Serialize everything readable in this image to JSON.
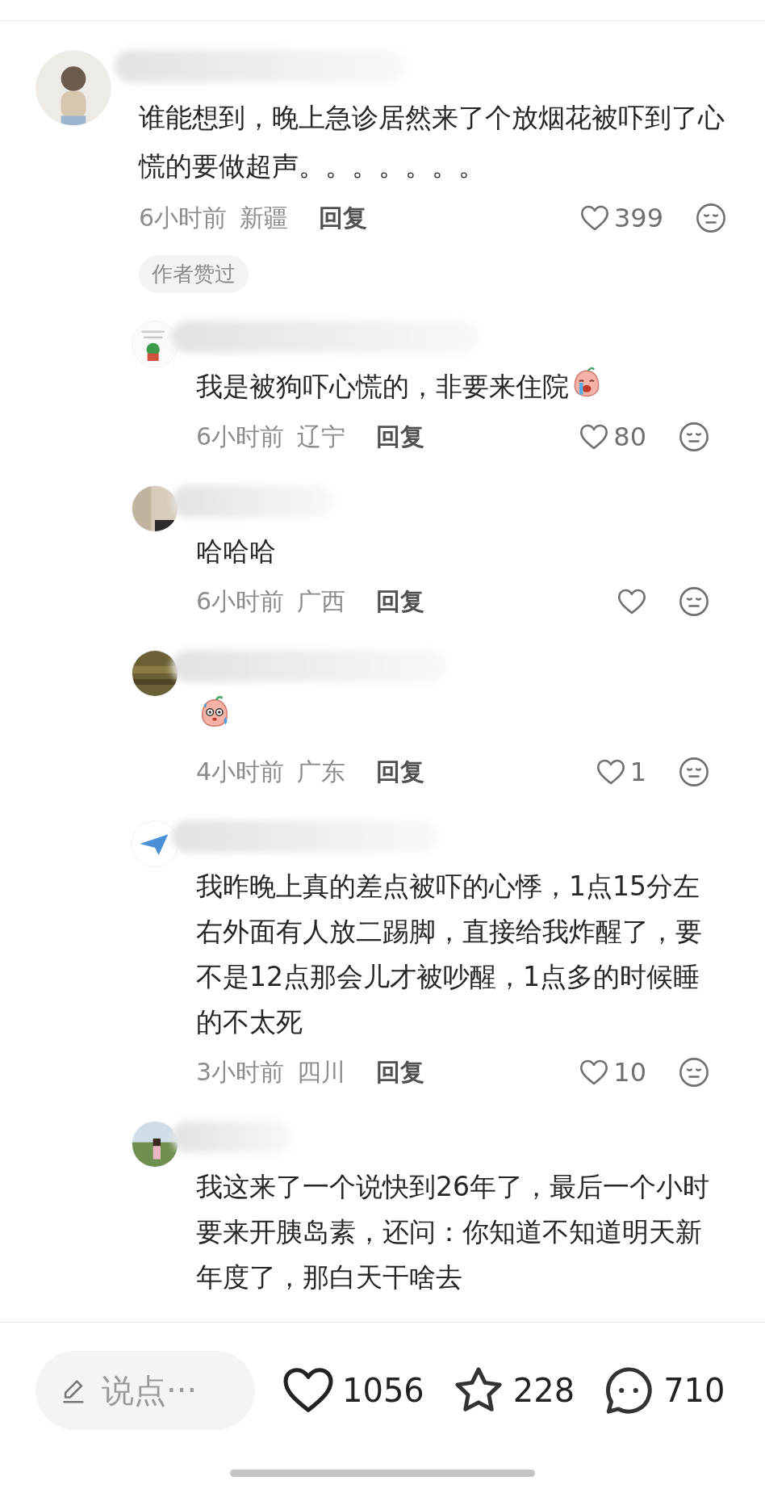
{
  "comments": [
    {
      "text": "谁能想到，晚上急诊居然来了个放烟花被吓到了心慌的要做超声。。。。。。。",
      "time": "6小时前",
      "location": "新疆",
      "reply_label": "回复",
      "likes": "399",
      "badge": "作者赞过",
      "children": [
        {
          "text": "我是被狗吓心慌的，非要来住院",
          "sticker": {
            "kind": "crying"
          },
          "time": "6小时前",
          "location": "辽宁",
          "reply_label": "回复",
          "likes": "80"
        },
        {
          "text": "哈哈哈",
          "time": "6小时前",
          "location": "广西",
          "reply_label": "回复"
        },
        {
          "sticker": {
            "kind": "sweating"
          },
          "time": "4小时前",
          "location": "广东",
          "reply_label": "回复",
          "likes": "1"
        },
        {
          "text": "我昨晚上真的差点被吓的心悸，1点15分左右外面有人放二踢脚，直接给我炸醒了，要不是12点那会儿才被吵醒，1点多的时候睡的不太死",
          "time": "3小时前",
          "location": "四川",
          "reply_label": "回复",
          "likes": "10"
        },
        {
          "text": "我这来了一个说快到26年了，最后一个小时要来开胰岛素，还问：你知道不知道明天新年度了，那白天干啥去"
        }
      ]
    }
  ],
  "bottom_bar": {
    "comment_input": {
      "placeholder": "说点···"
    },
    "likes": "1056",
    "favorites": "228",
    "comments": "710"
  }
}
